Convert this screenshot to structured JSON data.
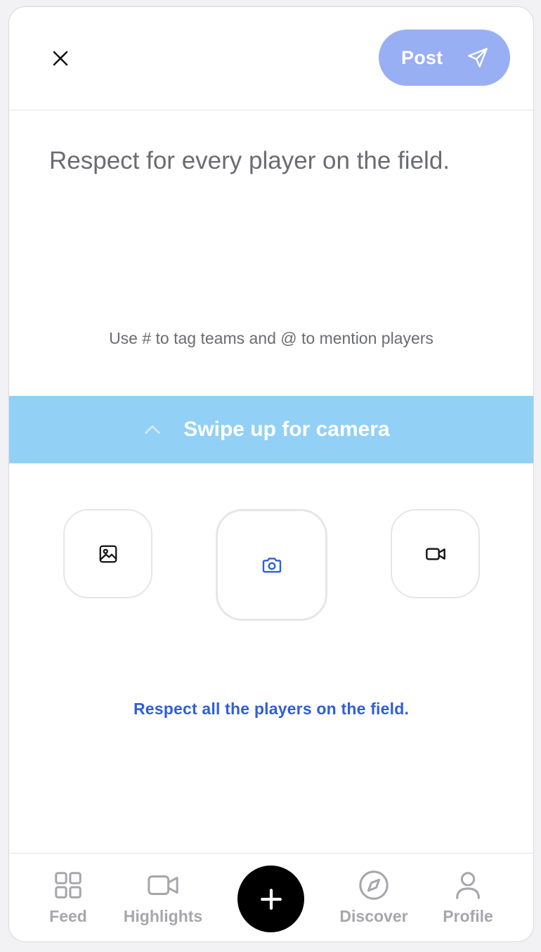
{
  "header": {
    "close_icon": "close-icon",
    "post_label": "Post",
    "post_icon": "send-icon",
    "post_color": "#99aff3"
  },
  "composer": {
    "text": "Respect for every player on the field.",
    "hint": "Use # to tag teams and @ to mention players"
  },
  "swipe": {
    "label": "Swipe up for camera",
    "icon": "chevron-up-icon",
    "color": "#92d0f5"
  },
  "media": {
    "buttons": [
      {
        "icon": "image-icon"
      },
      {
        "icon": "camera-icon"
      },
      {
        "icon": "video-icon"
      }
    ]
  },
  "notice": {
    "text": "Respect all the players on the field.",
    "color": "#2f5fd6"
  },
  "tabbar": {
    "items": [
      {
        "label": "Feed",
        "icon": "grid-icon"
      },
      {
        "label": "Highlights",
        "icon": "video-icon"
      },
      {
        "label": "",
        "icon": "plus-icon"
      },
      {
        "label": "Discover",
        "icon": "compass-icon"
      },
      {
        "label": "Profile",
        "icon": "user-icon"
      }
    ]
  }
}
